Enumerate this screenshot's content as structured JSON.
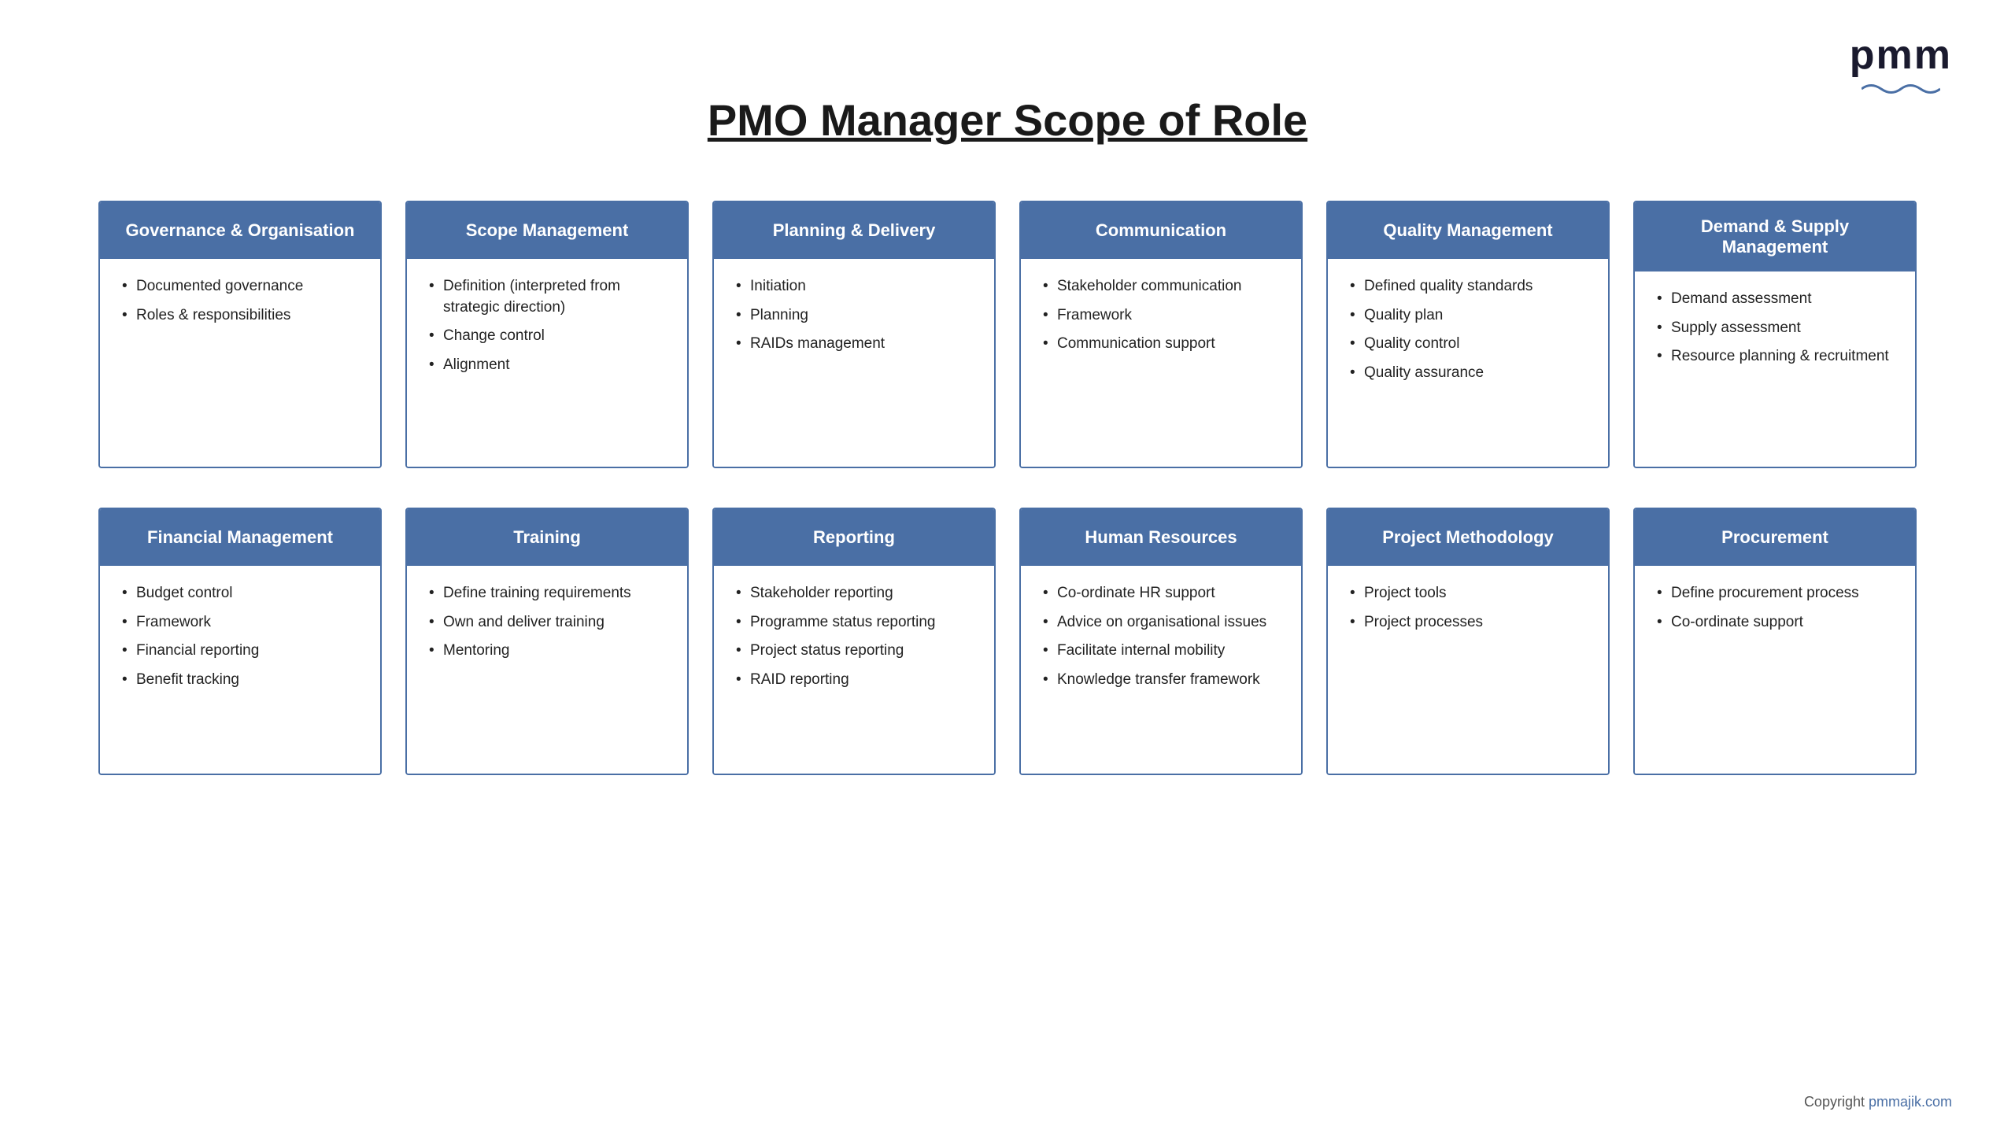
{
  "page": {
    "title": "PMO Manager Scope of Role",
    "copyright_text": "Copyright ",
    "copyright_link": "pmmajik.com",
    "logo": "pmm"
  },
  "row1": [
    {
      "id": "governance",
      "header": "Governance & Organisation",
      "items": [
        "Documented governance",
        "Roles & responsibilities"
      ]
    },
    {
      "id": "scope",
      "header": "Scope Management",
      "items": [
        "Definition (interpreted from strategic direction)",
        "Change control",
        "Alignment"
      ]
    },
    {
      "id": "planning",
      "header": "Planning & Delivery",
      "items": [
        "Initiation",
        "Planning",
        "RAIDs management"
      ]
    },
    {
      "id": "communication",
      "header": "Communication",
      "items": [
        "Stakeholder communication",
        "Framework",
        "Communication support"
      ]
    },
    {
      "id": "quality",
      "header": "Quality Management",
      "items": [
        "Defined quality standards",
        "Quality plan",
        "Quality control",
        "Quality assurance"
      ]
    },
    {
      "id": "demand",
      "header": "Demand & Supply Management",
      "items": [
        "Demand assessment",
        "Supply assessment",
        "Resource planning & recruitment"
      ]
    }
  ],
  "row2": [
    {
      "id": "financial",
      "header": "Financial Management",
      "items": [
        "Budget control",
        "Framework",
        "Financial reporting",
        "Benefit tracking"
      ]
    },
    {
      "id": "training",
      "header": "Training",
      "items": [
        "Define training requirements",
        "Own and deliver training",
        "Mentoring"
      ]
    },
    {
      "id": "reporting",
      "header": "Reporting",
      "items": [
        "Stakeholder reporting",
        "Programme status reporting",
        "Project status reporting",
        "RAID reporting"
      ]
    },
    {
      "id": "hr",
      "header": "Human Resources",
      "items": [
        "Co-ordinate HR support",
        "Advice on organisational issues",
        "Facilitate internal mobility",
        "Knowledge transfer framework"
      ]
    },
    {
      "id": "methodology",
      "header": "Project Methodology",
      "items": [
        "Project tools",
        "Project processes"
      ]
    },
    {
      "id": "procurement",
      "header": "Procurement",
      "items": [
        "Define procurement process",
        "Co-ordinate support"
      ]
    }
  ]
}
